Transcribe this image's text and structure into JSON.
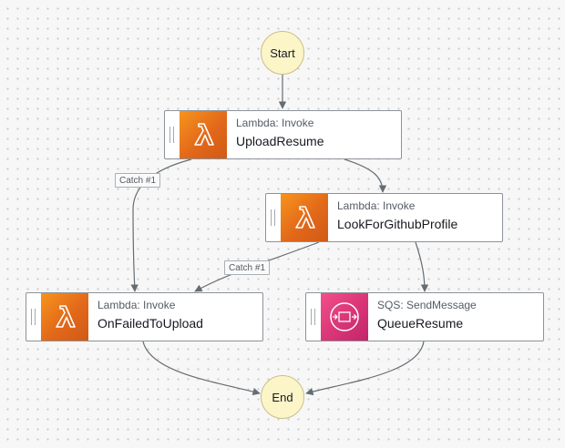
{
  "workflow": {
    "start": {
      "label": "Start"
    },
    "end": {
      "label": "End"
    },
    "states": [
      {
        "id": "upload",
        "type": "Lambda: Invoke",
        "name": "UploadResume",
        "icon": "lambda-icon",
        "color": "#e8761b"
      },
      {
        "id": "lookup",
        "type": "Lambda: Invoke",
        "name": "LookForGithubProfile",
        "icon": "lambda-icon",
        "color": "#e8761b"
      },
      {
        "id": "failed",
        "type": "Lambda: Invoke",
        "name": "OnFailedToUpload",
        "icon": "lambda-icon",
        "color": "#e8761b"
      },
      {
        "id": "queue",
        "type": "SQS: SendMessage",
        "name": "QueueResume",
        "icon": "sqs-icon",
        "color": "#e2417f"
      }
    ],
    "catch_labels": [
      "Catch #1",
      "Catch #1"
    ],
    "colors": {
      "terminal_fill": "#fcf5c8",
      "edge": "#656c72"
    }
  }
}
